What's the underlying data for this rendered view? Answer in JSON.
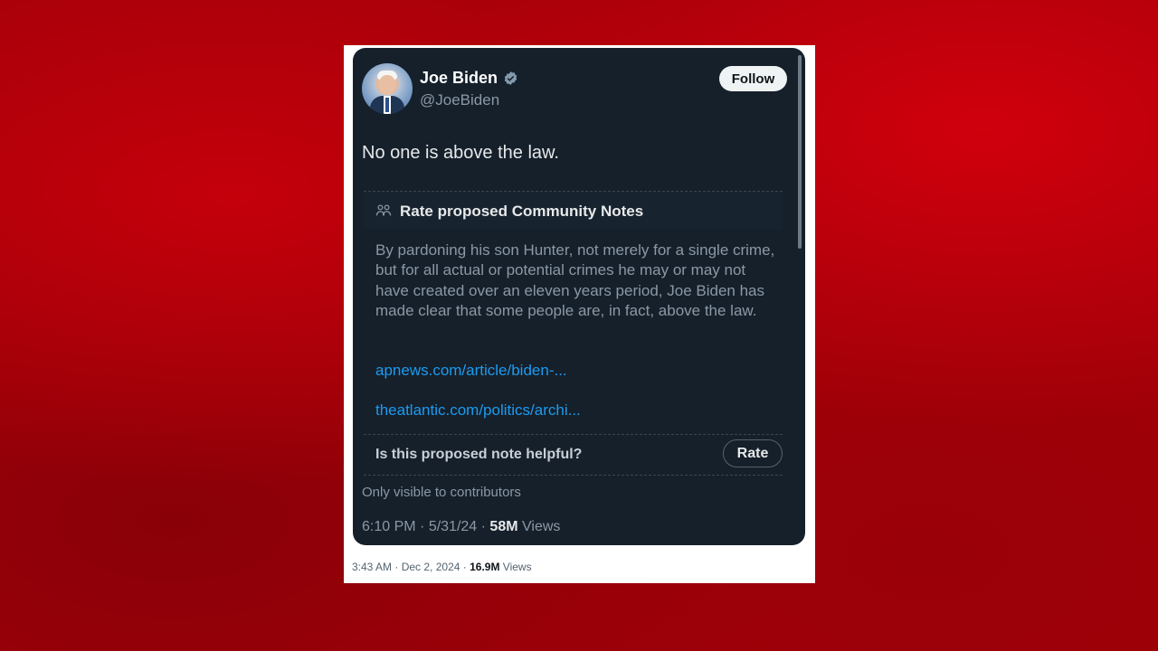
{
  "tweet": {
    "display_name": "Joe Biden",
    "handle": "@JoeBiden",
    "follow_label": "Follow",
    "text": "No one is above the law.",
    "time": "6:10 PM",
    "date": "5/31/24",
    "views_count": "58M",
    "views_label": "Views",
    "only_visible": "Only visible to contributors"
  },
  "community_note": {
    "title": "Rate proposed Community Notes",
    "body": "By pardoning his son Hunter, not merely for a single crime, but for all actual or potential crimes he may or may not have created over an eleven years period, Joe Biden has made clear that some people are, in fact, above the law.",
    "links": [
      "apnews.com/article/biden-...",
      "theatlantic.com/politics/archi..."
    ],
    "question": "Is this proposed note helpful?",
    "rate_label": "Rate"
  },
  "outer_post": {
    "time": "3:43 AM",
    "date": "Dec 2, 2024",
    "views_count": "16.9M",
    "views_label": "Views"
  },
  "icons": {
    "verified": "verified-badge-icon",
    "notes": "people-icon"
  },
  "colors": {
    "background": "#a30009",
    "card": "#15202b",
    "link": "#1d9bf0",
    "secondary_text": "#8b98a5"
  }
}
